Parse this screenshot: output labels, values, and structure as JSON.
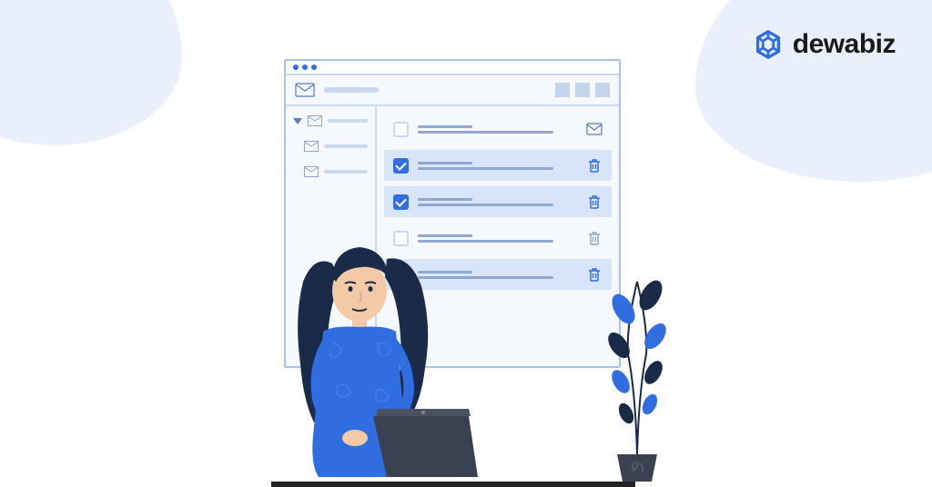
{
  "brand": {
    "name": "dewabiz"
  },
  "colors": {
    "accent": "#2f6de0",
    "bg_soft": "#eaf0fb",
    "panel": "#f5f8fd",
    "line": "#c9d9f0"
  },
  "window": {
    "title_dots": 3,
    "toolbar": {
      "icon": "envelope-icon",
      "view_squares": 3
    },
    "sidebar": {
      "items": [
        {
          "icon": "envelope-icon",
          "expanded": true
        },
        {
          "icon": "envelope-icon"
        },
        {
          "icon": "envelope-icon"
        }
      ]
    },
    "rows": [
      {
        "checked": false,
        "action": "envelope-icon"
      },
      {
        "checked": true,
        "action": "trash-icon"
      },
      {
        "checked": true,
        "action": "trash-icon"
      },
      {
        "checked": false,
        "action": "trash-icon"
      },
      {
        "checked": true,
        "action": "trash-icon"
      }
    ]
  }
}
